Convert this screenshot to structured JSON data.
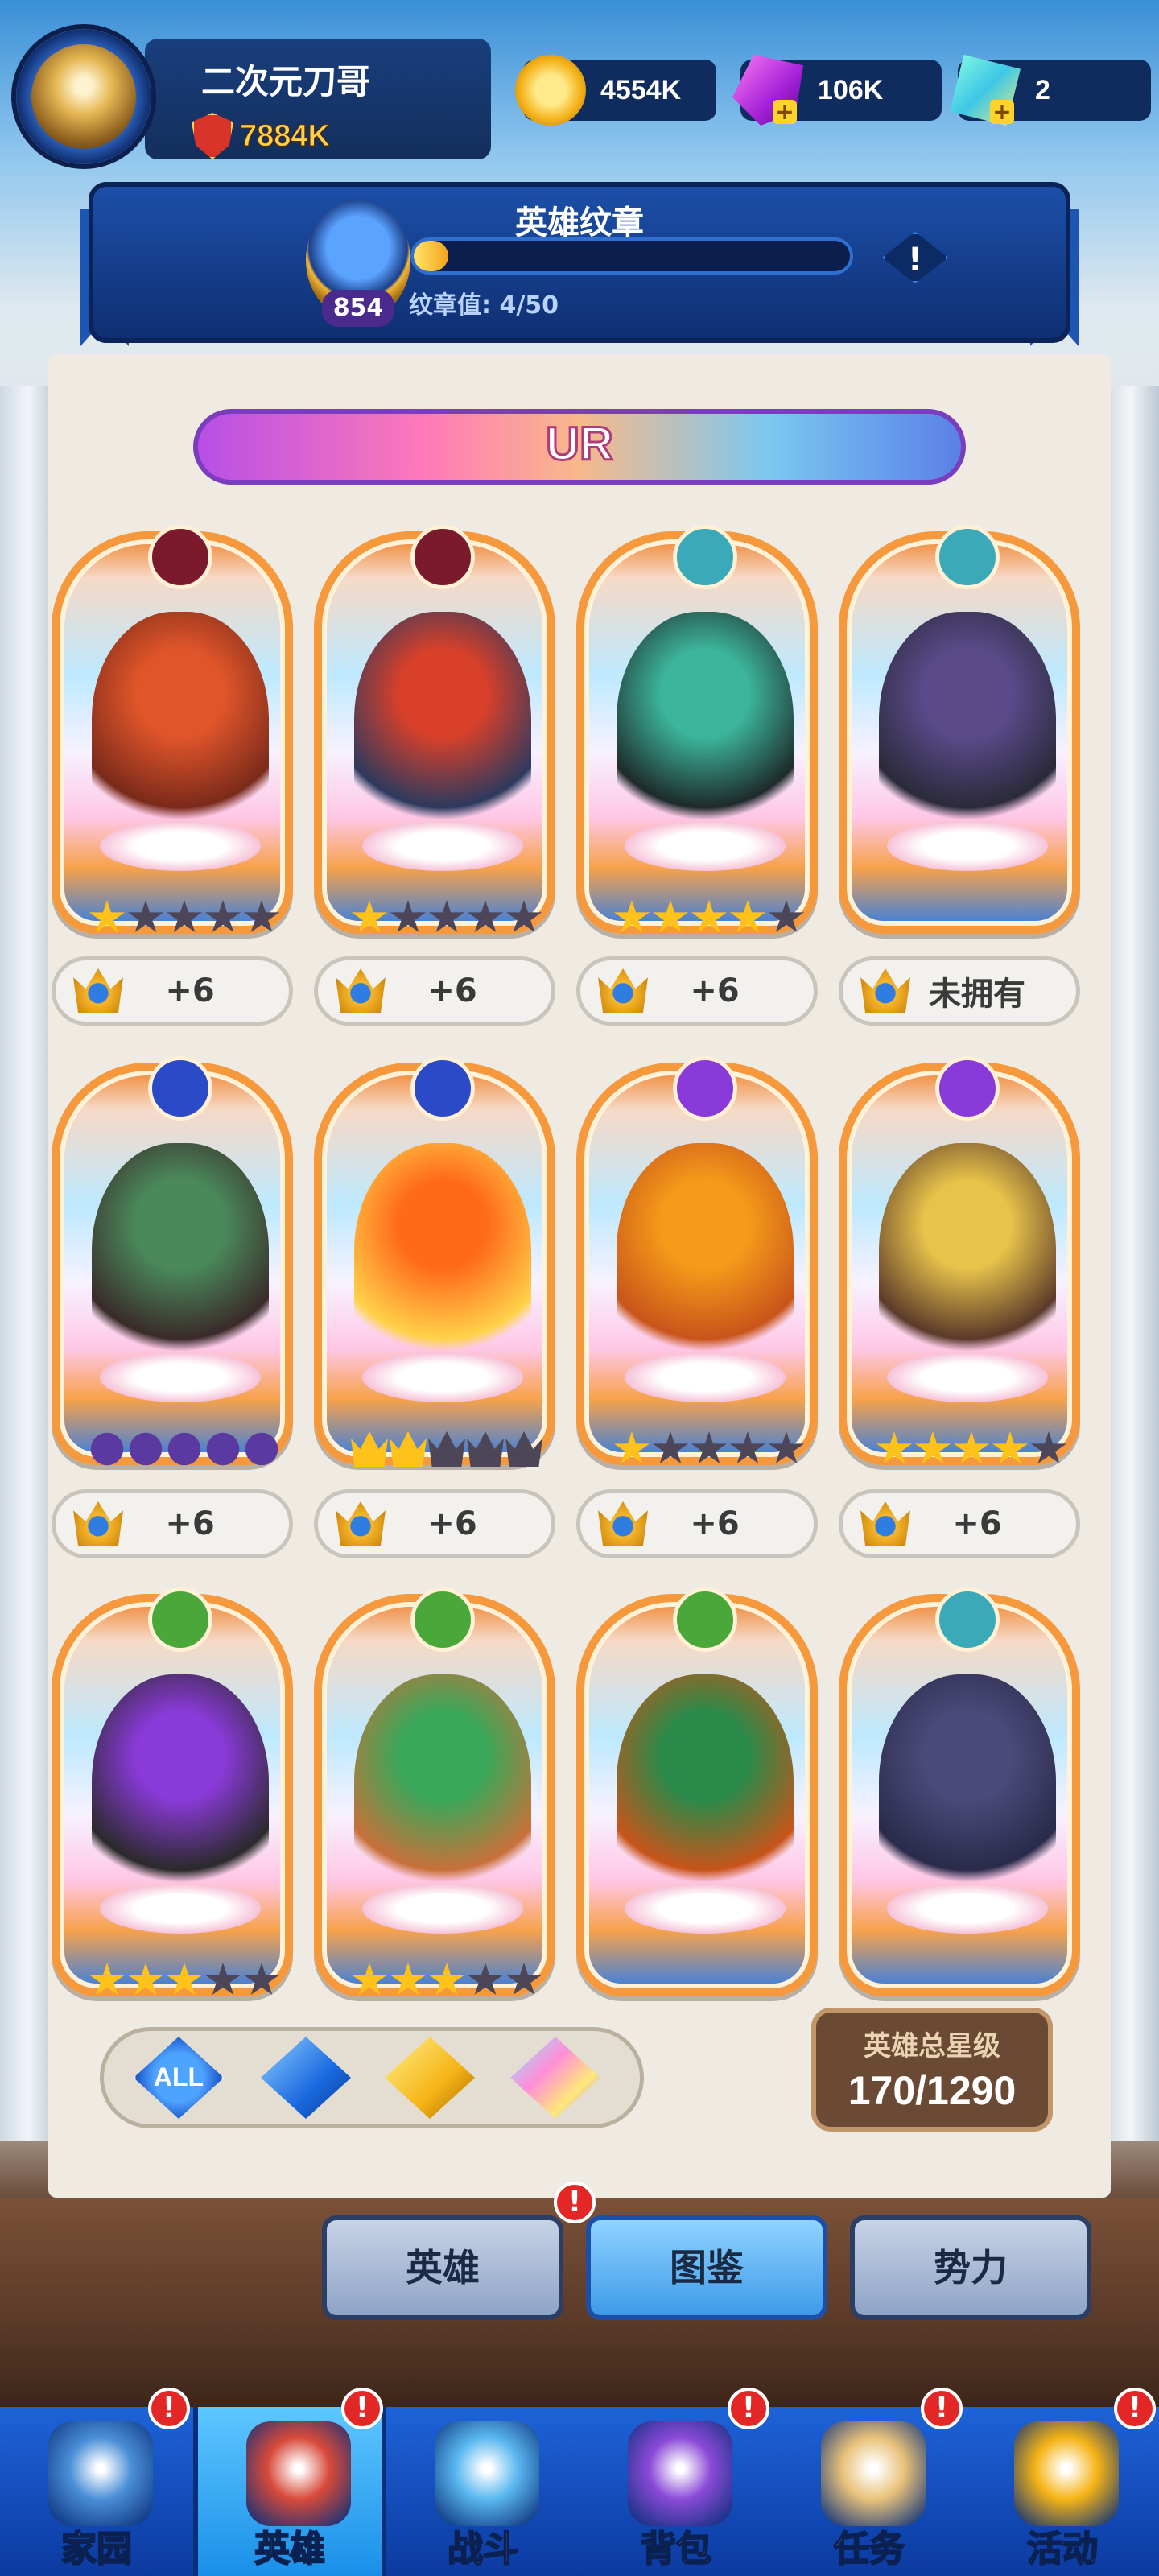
{
  "player": {
    "name": "二次元刀哥",
    "power": "7884K"
  },
  "currencies": [
    {
      "id": "gold",
      "icon": "gold-coin-icon",
      "value": "4554K"
    },
    {
      "id": "gem",
      "icon": "purple-gem-icon",
      "value": "106K"
    },
    {
      "id": "crystal",
      "icon": "rainbow-crystal-icon",
      "value": "2"
    }
  ],
  "badge": {
    "title": "英雄纹章",
    "level": "854",
    "progress_text": "纹章值: 4/50",
    "progress_current": 4,
    "progress_max": 50,
    "info_label": "!"
  },
  "rarity": {
    "label": "UR"
  },
  "heroes": [
    {
      "icon": "demon-hero-icon",
      "emblem_color": "#7a1a2a",
      "figure_colors": [
        "#e0552a",
        "#7a2a1a"
      ],
      "stars": 1,
      "star_type": "star",
      "badge_text": "+6"
    },
    {
      "icon": "orc-warrior-icon",
      "emblem_color": "#7a1a2a",
      "figure_colors": [
        "#d8402a",
        "#2c3a5e"
      ],
      "stars": 1,
      "star_type": "star",
      "badge_text": "+6"
    },
    {
      "icon": "panda-hero-icon",
      "emblem_color": "#3aa9b8",
      "figure_colors": [
        "#3cb59a",
        "#1e2a2a"
      ],
      "stars": 4,
      "star_type": "star",
      "badge_text": "+6"
    },
    {
      "icon": "dark-elf-icon",
      "emblem_color": "#3aa9b8",
      "figure_colors": [
        "#5a4a8a",
        "#2a2a3a"
      ],
      "stars": 0,
      "star_type": "none",
      "badge_text": "未拥有"
    },
    {
      "icon": "medusa-hero-icon",
      "emblem_color": "#2a4ac8",
      "figure_colors": [
        "#4a8a5a",
        "#3a2a2a"
      ],
      "stars": 0,
      "star_type": "moon",
      "badge_text": "+6"
    },
    {
      "icon": "phoenix-hero-icon",
      "emblem_color": "#2a4ac8",
      "figure_colors": [
        "#ff6a1a",
        "#ffd24a"
      ],
      "stars": 2,
      "star_type": "crown",
      "badge_text": "+6"
    },
    {
      "icon": "fire-paladin-icon",
      "emblem_color": "#8a3ad8",
      "figure_colors": [
        "#f59a1a",
        "#c8541a"
      ],
      "stars": 1,
      "star_type": "star",
      "badge_text": "+6"
    },
    {
      "icon": "golden-knight-icon",
      "emblem_color": "#8a3ad8",
      "figure_colors": [
        "#e8c24a",
        "#5a3a2a"
      ],
      "stars": 4,
      "star_type": "star",
      "badge_text": "+6"
    },
    {
      "icon": "druid-rider-icon",
      "emblem_color": "#4aa83a",
      "figure_colors": [
        "#8a3ad8",
        "#2a2a2a"
      ],
      "stars": 3,
      "star_type": "star",
      "badge_text": ""
    },
    {
      "icon": "forest-dragon-icon",
      "emblem_color": "#4aa83a",
      "figure_colors": [
        "#3aa85a",
        "#c8703a"
      ],
      "stars": 3,
      "star_type": "star",
      "badge_text": ""
    },
    {
      "icon": "elf-archer-icon",
      "emblem_color": "#4aa83a",
      "figure_colors": [
        "#2a8a4a",
        "#c8541a"
      ],
      "stars": 0,
      "star_type": "none",
      "badge_text": ""
    },
    {
      "icon": "shadow-beast-icon",
      "emblem_color": "#3aa9b8",
      "figure_colors": [
        "#4a4a7a",
        "#2a2a4a"
      ],
      "stars": 0,
      "star_type": "none",
      "badge_text": ""
    }
  ],
  "filters": [
    {
      "id": "all",
      "label": "ALL"
    },
    {
      "id": "blue",
      "icon": "blue-diamond-icon"
    },
    {
      "id": "gold",
      "icon": "gold-diamond-icon"
    },
    {
      "id": "rainbow",
      "icon": "rainbow-diamond-icon"
    }
  ],
  "total_stars": {
    "label": "英雄总星级",
    "value": "170/1290"
  },
  "sub_tabs": [
    {
      "label": "英雄",
      "active": false
    },
    {
      "label": "图鉴",
      "active": true
    },
    {
      "label": "势力",
      "active": false
    }
  ],
  "nav": [
    {
      "label": "家园",
      "icon": "home-castle-icon",
      "alert": true,
      "active": false
    },
    {
      "label": "英雄",
      "icon": "hero-face-icon",
      "alert": true,
      "active": true
    },
    {
      "label": "战斗",
      "icon": "crossed-swords-icon",
      "alert": false,
      "active": false
    },
    {
      "label": "背包",
      "icon": "backpack-chest-icon",
      "alert": true,
      "active": false
    },
    {
      "label": "任务",
      "icon": "quest-scroll-icon",
      "alert": true,
      "active": false
    },
    {
      "label": "活动",
      "icon": "event-crown-icon",
      "alert": true,
      "active": false
    }
  ],
  "alert_glyph": "!"
}
